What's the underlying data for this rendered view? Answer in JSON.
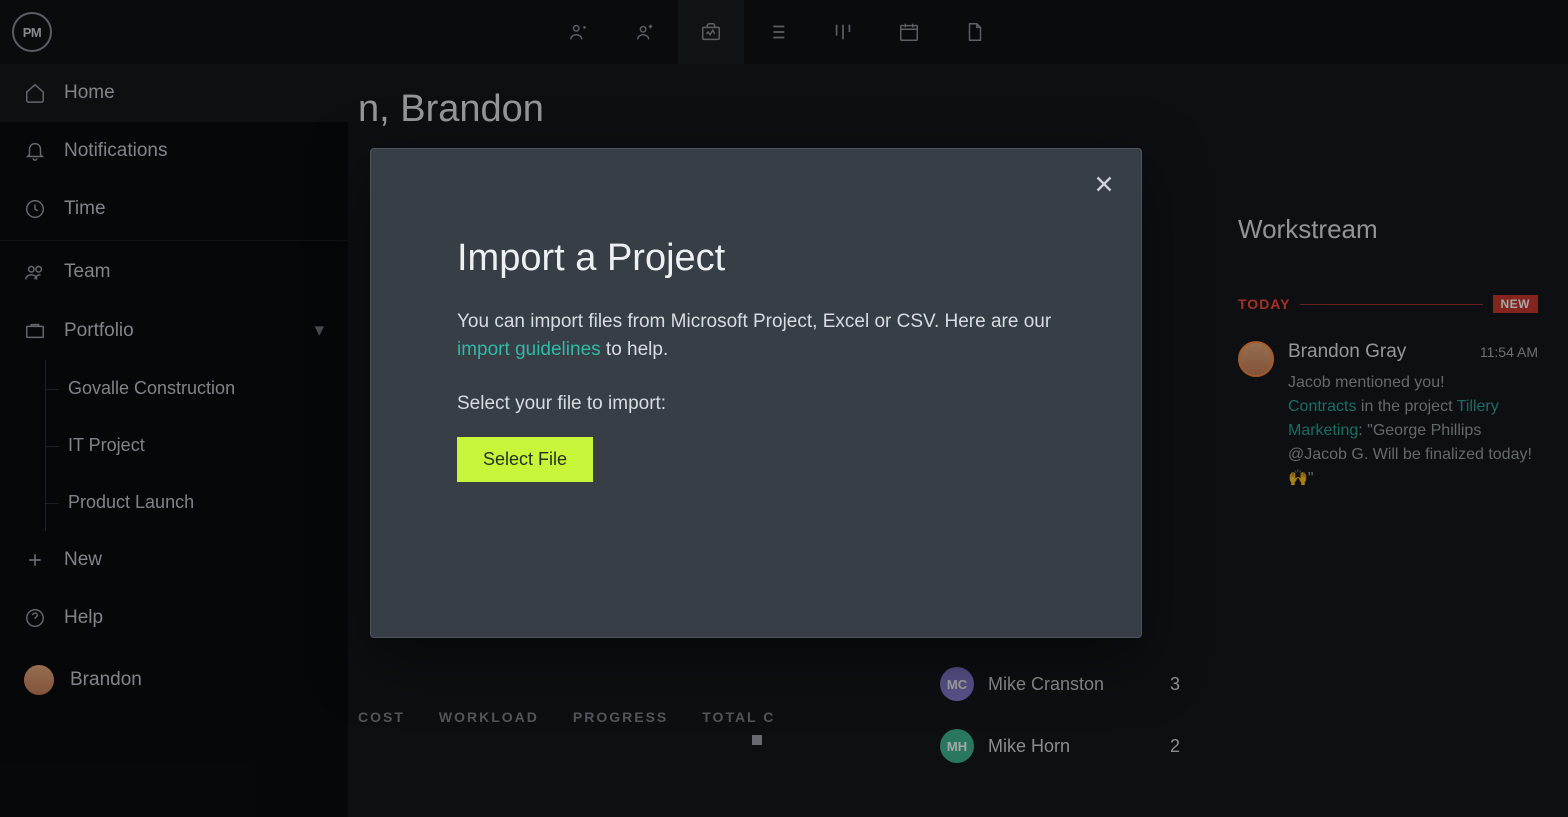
{
  "logo": "PM",
  "sidebar": {
    "items": [
      {
        "icon": "home",
        "label": "Home"
      },
      {
        "icon": "bell",
        "label": "Notifications"
      },
      {
        "icon": "clock",
        "label": "Time"
      },
      {
        "icon": "team",
        "label": "Team"
      },
      {
        "icon": "briefcase",
        "label": "Portfolio"
      }
    ],
    "portfolio_items": [
      {
        "label": "Govalle Construction"
      },
      {
        "label": "IT Project"
      },
      {
        "label": "Product Launch"
      }
    ],
    "new_label": "New",
    "help_label": "Help",
    "user": "Brandon"
  },
  "greeting_fragment": "n, Brandon",
  "tabs": [
    "COST",
    "WORKLOAD",
    "PROGRESS",
    "TOTAL C"
  ],
  "team_list": [
    {
      "initials": "MC",
      "name": "Mike Cranston",
      "count": "3",
      "color": "#8a7fd6"
    },
    {
      "initials": "MH",
      "name": "Mike Horn",
      "count": "2",
      "color": "#3fb795"
    }
  ],
  "workstream": {
    "title": "Workstream",
    "today": "TODAY",
    "new_badge": "NEW",
    "item": {
      "name": "Brandon Gray",
      "time": "11:54 AM",
      "line1": "Jacob mentioned you!",
      "link1": "Contracts",
      "mid1": " in the project ",
      "link2": "Tillery Marketing",
      "rest": ": \"George Phillips @Jacob G. Will be finalized today! 🙌\""
    }
  },
  "modal": {
    "title": "Import a Project",
    "p_before": "You can import files from Microsoft Project, Excel or CSV. Here are our ",
    "link": "import guidelines",
    "p_after": " to help.",
    "sub": "Select your file to import:",
    "button": "Select File"
  }
}
